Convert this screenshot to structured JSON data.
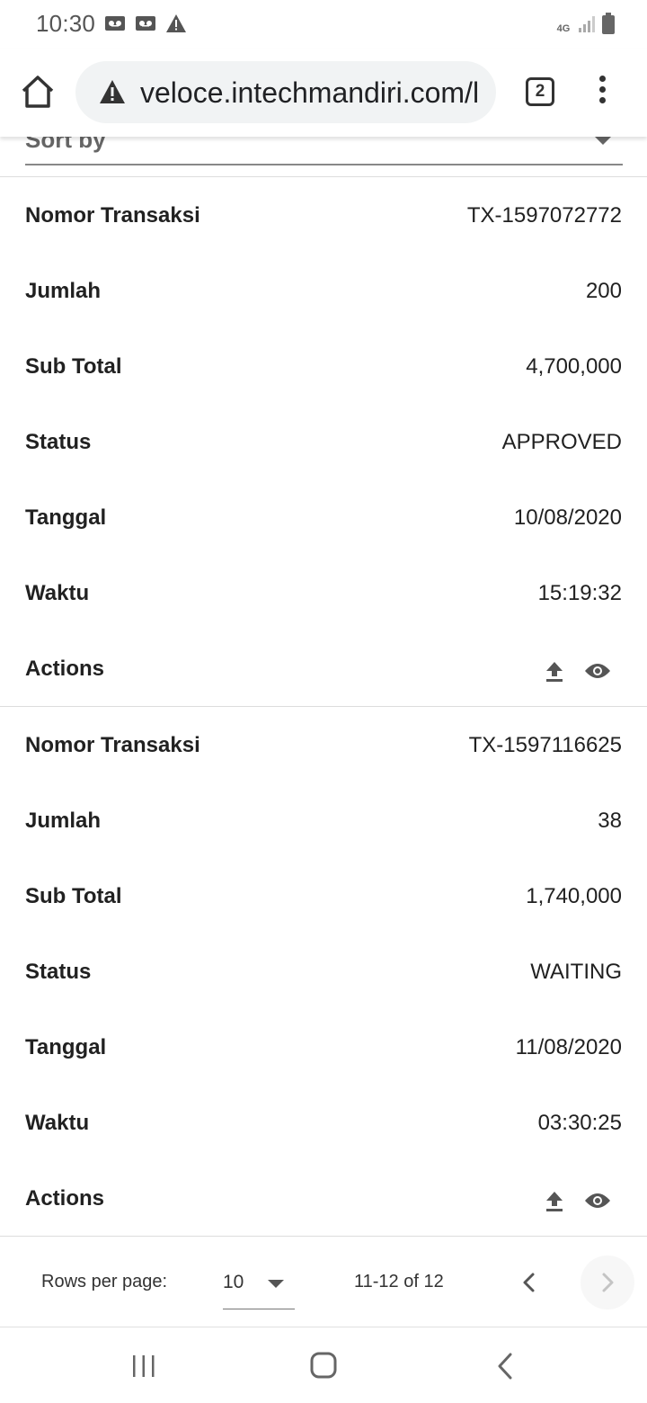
{
  "status_bar": {
    "time": "10:30",
    "network": "4G",
    "icons": [
      "voicemail-icon",
      "voicemail-icon",
      "alert-icon",
      "signal-icon",
      "battery-icon"
    ]
  },
  "browser": {
    "url": "veloce.intechmandiri.com/l",
    "tab_count": "2",
    "icons": [
      "home-icon",
      "warning-icon",
      "more-vert-icon"
    ]
  },
  "sort": {
    "label": "Sort by"
  },
  "records": [
    {
      "rows": [
        {
          "label": "Nomor Transaksi",
          "value": "TX-1597072772"
        },
        {
          "label": "Jumlah",
          "value": "200"
        },
        {
          "label": "Sub Total",
          "value": "4,700,000"
        },
        {
          "label": "Status",
          "value": "APPROVED"
        },
        {
          "label": "Tanggal",
          "value": "10/08/2020"
        },
        {
          "label": "Waktu",
          "value": "15:19:32"
        }
      ],
      "actions_label": "Actions"
    },
    {
      "rows": [
        {
          "label": "Nomor Transaksi",
          "value": "TX-1597116625"
        },
        {
          "label": "Jumlah",
          "value": "38"
        },
        {
          "label": "Sub Total",
          "value": "1,740,000"
        },
        {
          "label": "Status",
          "value": "WAITING"
        },
        {
          "label": "Tanggal",
          "value": "11/08/2020"
        },
        {
          "label": "Waktu",
          "value": "03:30:25"
        }
      ],
      "actions_label": "Actions"
    }
  ],
  "pagination": {
    "rows_per_page_label": "Rows per page:",
    "rows_per_page_value": "10",
    "range": "11-12 of 12"
  },
  "colors": {
    "text": "#212121",
    "muted": "#666666",
    "url_pill": "#f1f3f4",
    "divider": "#dddddd"
  }
}
